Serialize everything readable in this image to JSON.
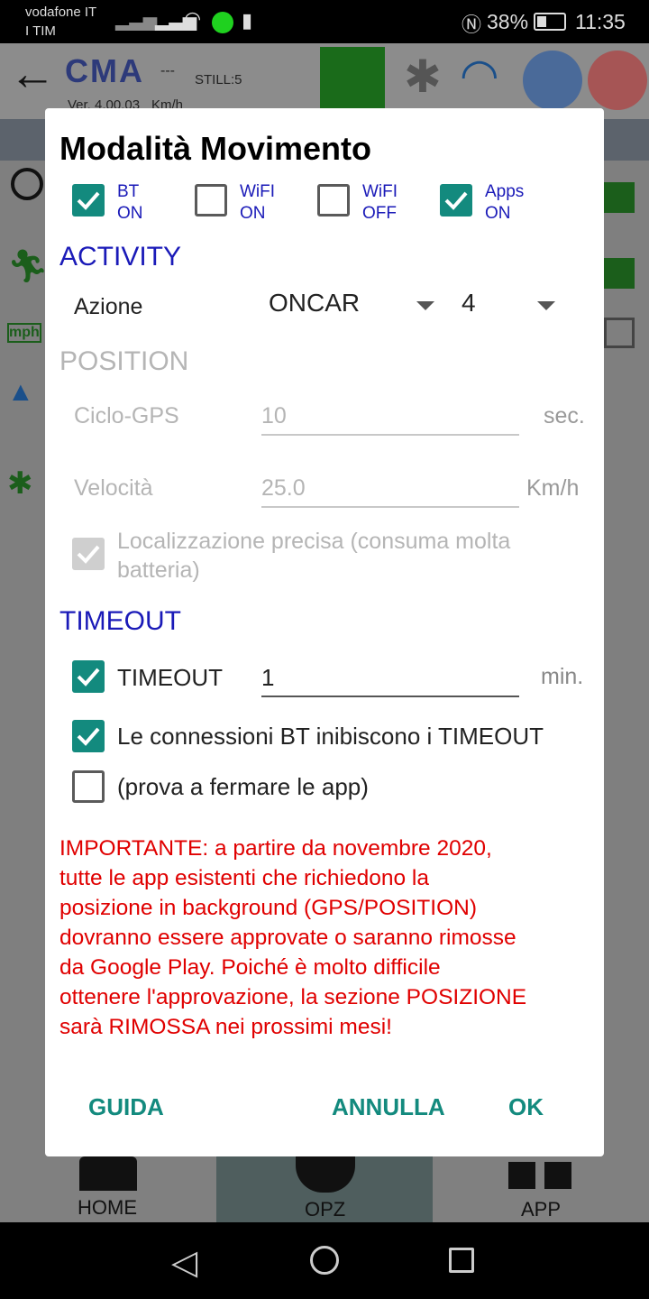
{
  "status_bar": {
    "carrier1": "vodafone IT",
    "carrier2": "I TIM",
    "battery": "38%",
    "time": "11:35"
  },
  "app_header": {
    "logo": "CMA",
    "dashes": "---",
    "still": "STILL:5",
    "version": "Ver. 4.00.03",
    "unit": "Km/h"
  },
  "bottom_nav": {
    "items": [
      {
        "label": "HOME"
      },
      {
        "label": "OPZ",
        "active": true
      },
      {
        "label": "APP"
      }
    ]
  },
  "dialog": {
    "title": "Modalità Movimento",
    "toggles": [
      {
        "l1": "BT",
        "l2": "ON",
        "checked": true
      },
      {
        "l1": "WiFI",
        "l2": "ON",
        "checked": false
      },
      {
        "l1": "WiFI",
        "l2": "OFF",
        "checked": false
      },
      {
        "l1": "Apps",
        "l2": "ON",
        "checked": true
      }
    ],
    "activity": {
      "header": "ACTIVITY",
      "label": "Azione",
      "mode": "ONCAR",
      "value": "4"
    },
    "position": {
      "header": "POSITION",
      "cycle_label": "Ciclo-GPS",
      "cycle_value": "10",
      "cycle_unit": "sec.",
      "speed_label": "Velocità",
      "speed_value": "25.0",
      "speed_unit": "Km/h",
      "precise_label": "Localizzazione precisa (consuma molta",
      "precise_label2": "batteria)",
      "precise_checked": true
    },
    "timeout": {
      "header": "TIMEOUT",
      "label": "TIMEOUT",
      "checked": true,
      "value": "1",
      "unit": "min.",
      "bt_label": "Le connessioni BT inibiscono i TIMEOUT",
      "bt_checked": true,
      "stop_label": "(prova a fermare le app)",
      "stop_checked": false
    },
    "warning": [
      "IMPORTANTE: a partire da novembre 2020,",
      "tutte le app esistenti che richiedono la",
      "posizione in background (GPS/POSITION)",
      "dovranno essere approvate o saranno rimosse",
      "da Google Play. Poiché è molto difficile",
      "ottenere l'approvazione, la sezione POSIZIONE",
      "sarà RIMOSSA nei prossimi mesi!"
    ],
    "buttons": {
      "help": "GUIDA",
      "cancel": "ANNULLA",
      "ok": "OK"
    }
  },
  "colors": {
    "accent": "#138a7e",
    "section": "#1a1ab8",
    "warning": "#e00000"
  }
}
